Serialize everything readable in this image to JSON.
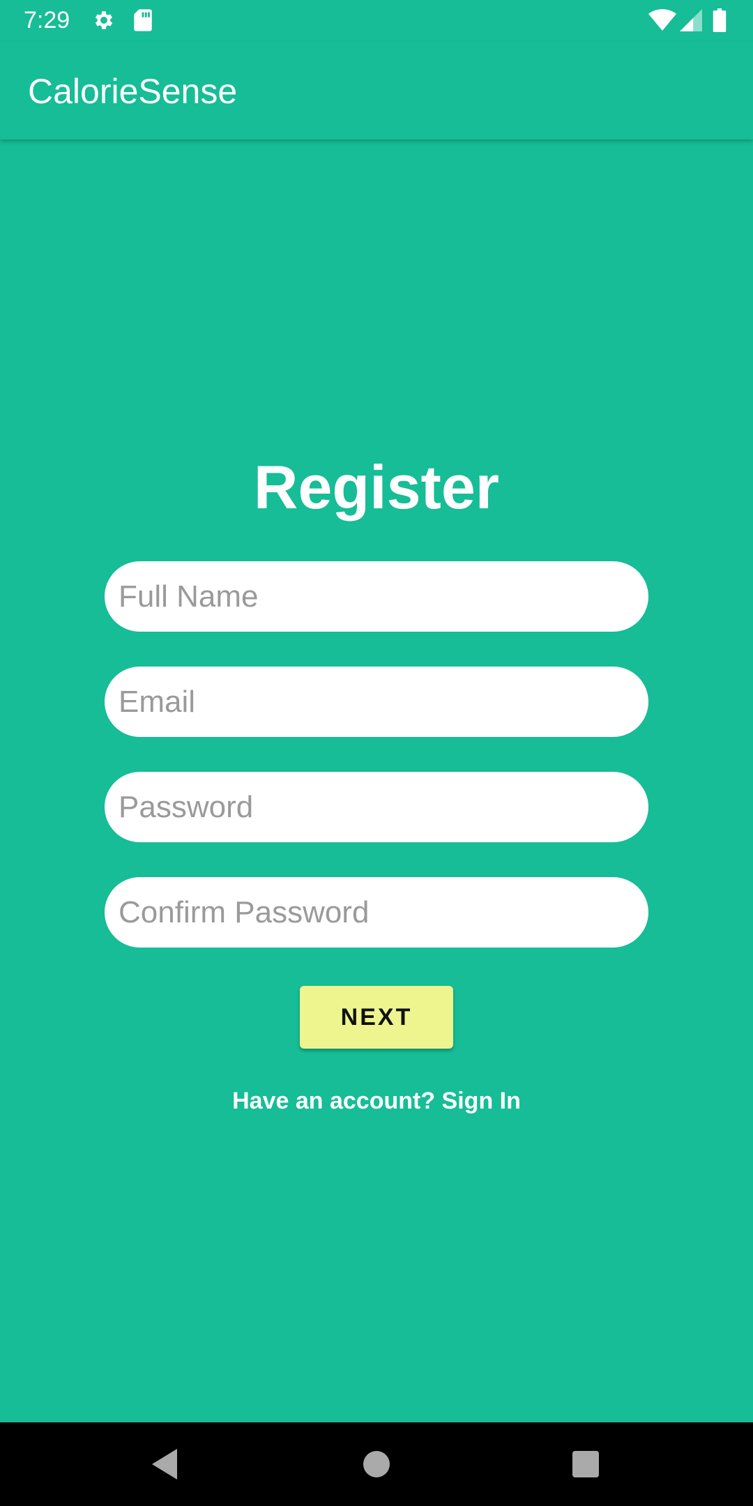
{
  "status_bar": {
    "time": "7:29",
    "icons": [
      "gear-icon",
      "sd-card-icon",
      "wifi-icon",
      "signal-icon",
      "battery-icon"
    ]
  },
  "app_bar": {
    "title": "CalorieSense"
  },
  "form": {
    "title": "Register",
    "full_name": {
      "placeholder": "Full Name",
      "value": ""
    },
    "email": {
      "placeholder": "Email",
      "value": ""
    },
    "password": {
      "placeholder": "Password",
      "value": ""
    },
    "confirm_password": {
      "placeholder": "Confirm Password",
      "value": ""
    },
    "next_label": "NEXT",
    "sign_in_text": "Have an account? Sign In"
  },
  "nav_bar": {
    "icons": [
      "back-icon",
      "home-icon",
      "recents-icon"
    ]
  },
  "colors": {
    "background": "#16BD96",
    "button": "#EEF58F",
    "field": "#FFFFFF",
    "placeholder": "#9A9A9A",
    "nav_bar": "#000000"
  }
}
